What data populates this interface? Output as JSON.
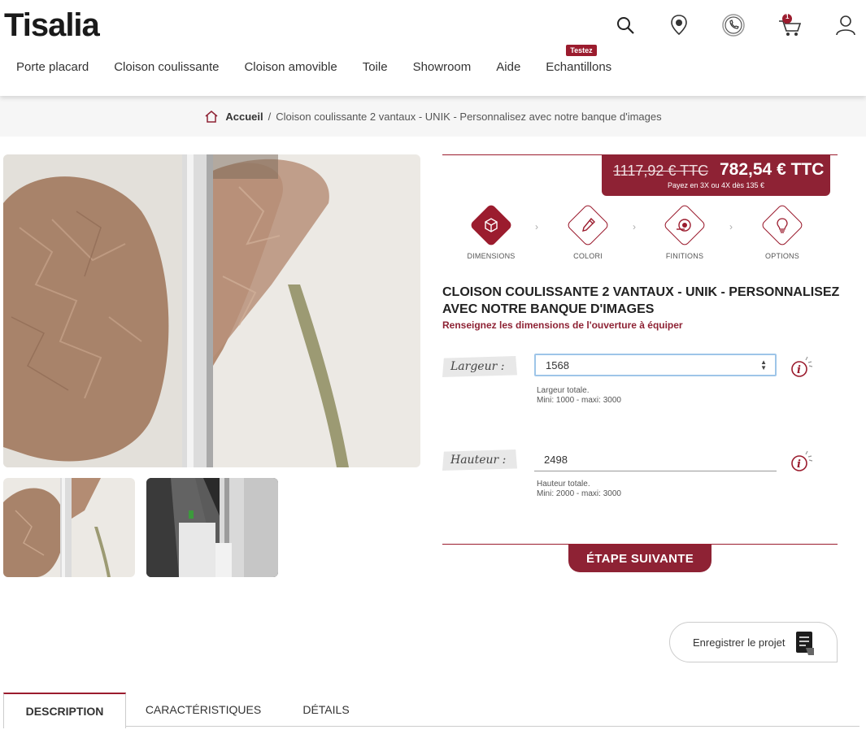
{
  "header": {
    "logo": "Tisalia",
    "nav": [
      "Porte placard",
      "Cloison coulissante",
      "Cloison amovible",
      "Toile",
      "Showroom",
      "Aide",
      "Echantillons"
    ],
    "nav_badge": "Testez",
    "cart_count": "1",
    "icons": [
      "search-icon",
      "store-locator-icon",
      "phone-icon",
      "cart-icon",
      "account-icon"
    ]
  },
  "breadcrumb": {
    "home": "Accueil",
    "separator": "/",
    "current": "Cloison coulissante 2 vantaux - UNIK - Personnalisez avec notre banque d'images"
  },
  "price": {
    "old": "1117,92 € TTC",
    "new": "782,54 € TTC",
    "sub": "Payez en 3X ou 4X dès 135 €"
  },
  "steps": [
    {
      "label": "DIMENSIONS",
      "active": true
    },
    {
      "label": "COLORI",
      "active": false
    },
    {
      "label": "FINITIONS",
      "active": false
    },
    {
      "label": "OPTIONS",
      "active": false
    }
  ],
  "product": {
    "title": "CLOISON COULISSANTE 2 VANTAUX - UNIK - PERSONNALISEZ AVEC NOTRE BANQUE D'IMAGES",
    "hint": "Renseignez les dimensions de l'ouverture à équiper"
  },
  "fields": {
    "width": {
      "label": "Largeur :",
      "value": "1568",
      "help1": "Largeur totale.",
      "help2": "Mini: 1000 - maxi: 3000"
    },
    "height": {
      "label": "Hauteur :",
      "value": "2498",
      "help1": "Hauteur totale.",
      "help2": "Mini: 2000 - maxi: 3000"
    }
  },
  "next_button": "ÉTAPE SUIVANTE",
  "save_button": "Enregistrer le projet",
  "tabs": [
    "DESCRIPTION",
    "CARACTÉRISTIQUES",
    "DÉTAILS"
  ],
  "colors": {
    "brand": "#8e2234"
  }
}
